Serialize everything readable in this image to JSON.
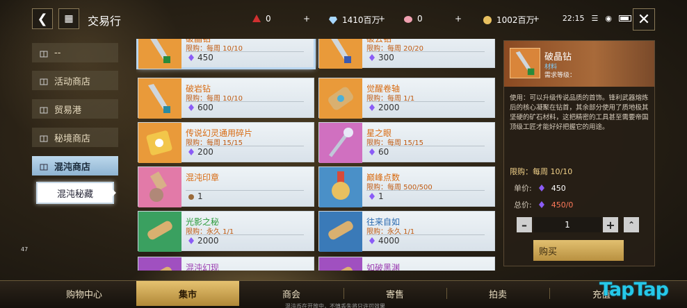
{
  "header": {
    "title": "交易行",
    "currencies": [
      {
        "icon": "red-crystal-icon",
        "value": "0"
      },
      {
        "icon": "diamond-icon",
        "value": "1410百万"
      },
      {
        "icon": "pink-shell-icon",
        "value": "0"
      },
      {
        "icon": "gold-coin-icon",
        "value": "1002百万"
      }
    ],
    "time": "22:15"
  },
  "sidebar": {
    "items": [
      {
        "label": "--"
      },
      {
        "label": "活动商店"
      },
      {
        "label": "贸易港"
      },
      {
        "label": "秘境商店"
      },
      {
        "label": "混沌商店"
      }
    ],
    "sub_item": "混沌秘藏"
  },
  "level_text": "47",
  "items": [
    {
      "name": "破晶钻",
      "limit": "限购：每周 10/10",
      "price": "450"
    },
    {
      "name": "破云钻",
      "limit": "限购：每周 20/20",
      "price": "300"
    },
    {
      "name": "破岩钻",
      "limit": "限购：每周 10/10",
      "price": "600"
    },
    {
      "name": "觉醒卷轴",
      "limit": "限购：每周 1/1",
      "price": "2000"
    },
    {
      "name": "传说幻灵通用碎片",
      "limit": "限购：每周 15/15",
      "price": "200"
    },
    {
      "name": "星之眼",
      "limit": "限购：每周 15/15",
      "price": "60"
    },
    {
      "name": "混沌印章",
      "limit": "",
      "price": "1"
    },
    {
      "name": "巅峰点数",
      "limit": "限购：每周 500/500",
      "price": "1"
    },
    {
      "name": "光影之秘",
      "limit": "限购：永久 1/1",
      "price": "2000"
    },
    {
      "name": "往来自如",
      "limit": "限购：永久 1/1",
      "price": "4000"
    },
    {
      "name": "混沌幻现",
      "limit": "",
      "price": ""
    },
    {
      "name": "如破黑渊",
      "limit": "",
      "price": ""
    }
  ],
  "detail": {
    "name": "破晶钻",
    "category": "材料",
    "requirement": "需求等级：",
    "description": "使用：可以升级传说品质的首饰。锋利武器熔炼后的核心凝聚在钻首，其余部分使用了质地极其坚硬的矿石材料，这把精密的工具甚至需要帝国顶级工匠才能好好把握它的用途。",
    "limit": "限购：每周 10/10",
    "unit_price_label": "单价:",
    "unit_price": "450",
    "total_label": "总价:",
    "total": "450/0",
    "quantity": "1",
    "buy_label": "购买"
  },
  "tabs": [
    "购物中心",
    "集市",
    "商会",
    "寄售",
    "拍卖",
    "充值"
  ],
  "footer_tip": "混沌币在开放中，不慎丢失将只许可效果",
  "watermark": "TapTap",
  "colors": {
    "accent": "#e6c270",
    "price_gem": "#8b5cf6",
    "name_orange": "#d86a10"
  }
}
